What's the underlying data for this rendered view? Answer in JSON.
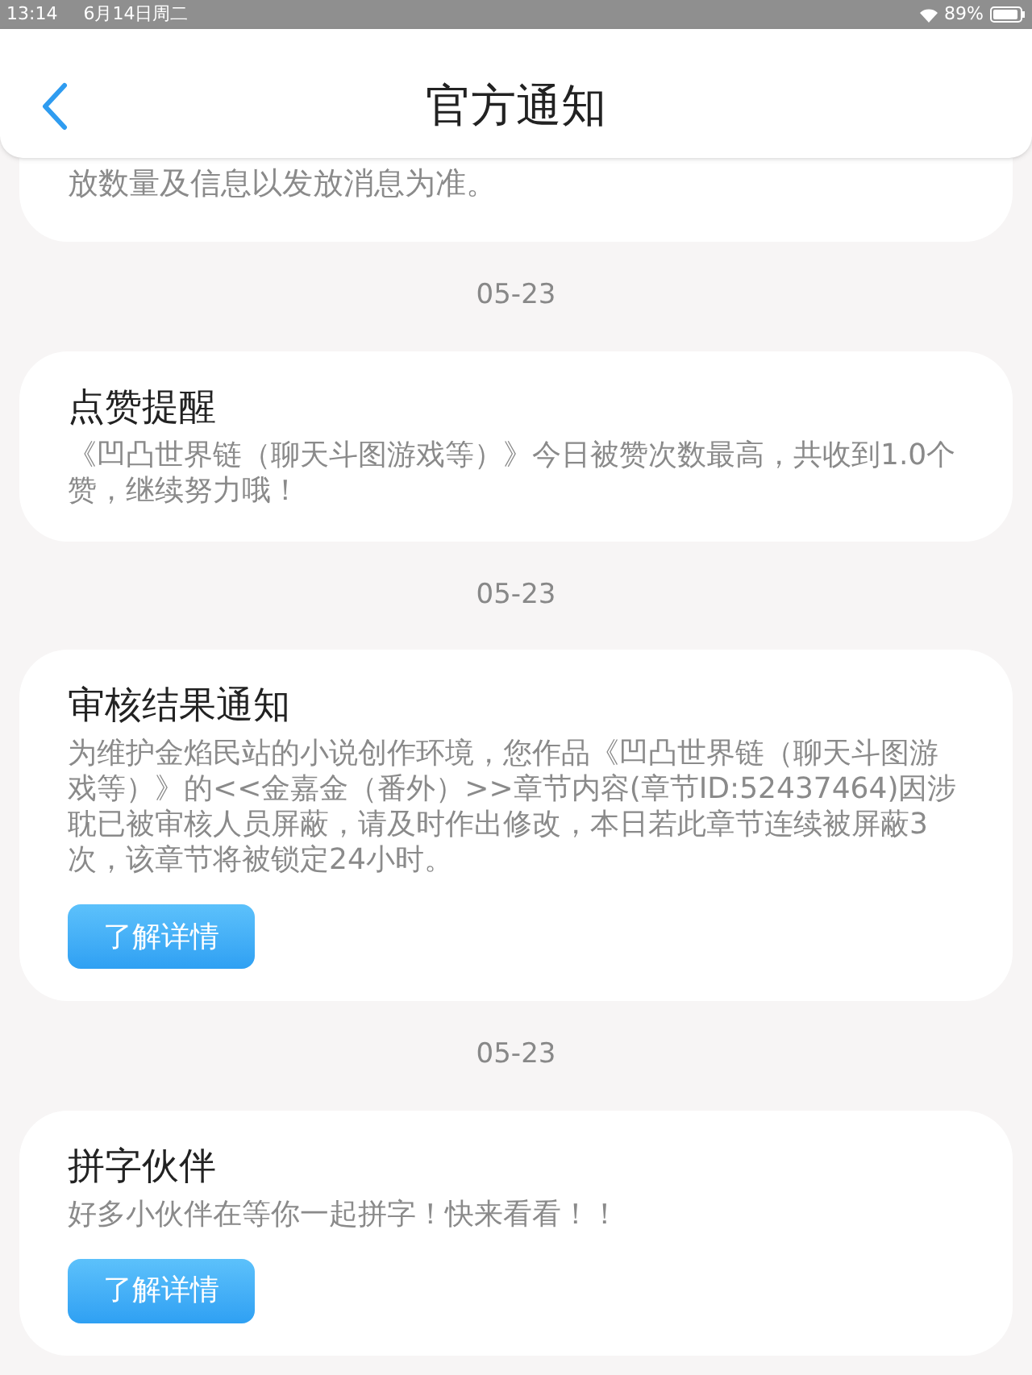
{
  "status_bar": {
    "time": "13:14",
    "date": "6月14日周二",
    "battery": "89%"
  },
  "header": {
    "title": "官方通知"
  },
  "notices": [
    {
      "kind": "fragment",
      "body": "放数量及信息以发放消息为准。"
    },
    {
      "kind": "notice",
      "date": "05-23",
      "title": "点赞提醒",
      "body": "《凹凸世界链（聊天斗图游戏等）》今日被赞次数最高，共收到1.0个赞，继续努力哦！"
    },
    {
      "kind": "notice",
      "date": "05-23",
      "title": "审核结果通知",
      "body": "为维护金焰民站的小说创作环境，您作品《凹凸世界链（聊天斗图游戏等）》的<<金嘉金（番外）>>章节内容(章节ID:52437464)因涉耽已被审核人员屏蔽，请及时作出修改，本日若此章节连续被屏蔽3次，该章节将被锁定24小时。",
      "button": "了解详情"
    },
    {
      "kind": "notice",
      "date": "05-23",
      "title": "拼字伙伴",
      "body": "好多小伙伴在等你一起拼字！快来看看！！",
      "button": "了解详情"
    }
  ]
}
